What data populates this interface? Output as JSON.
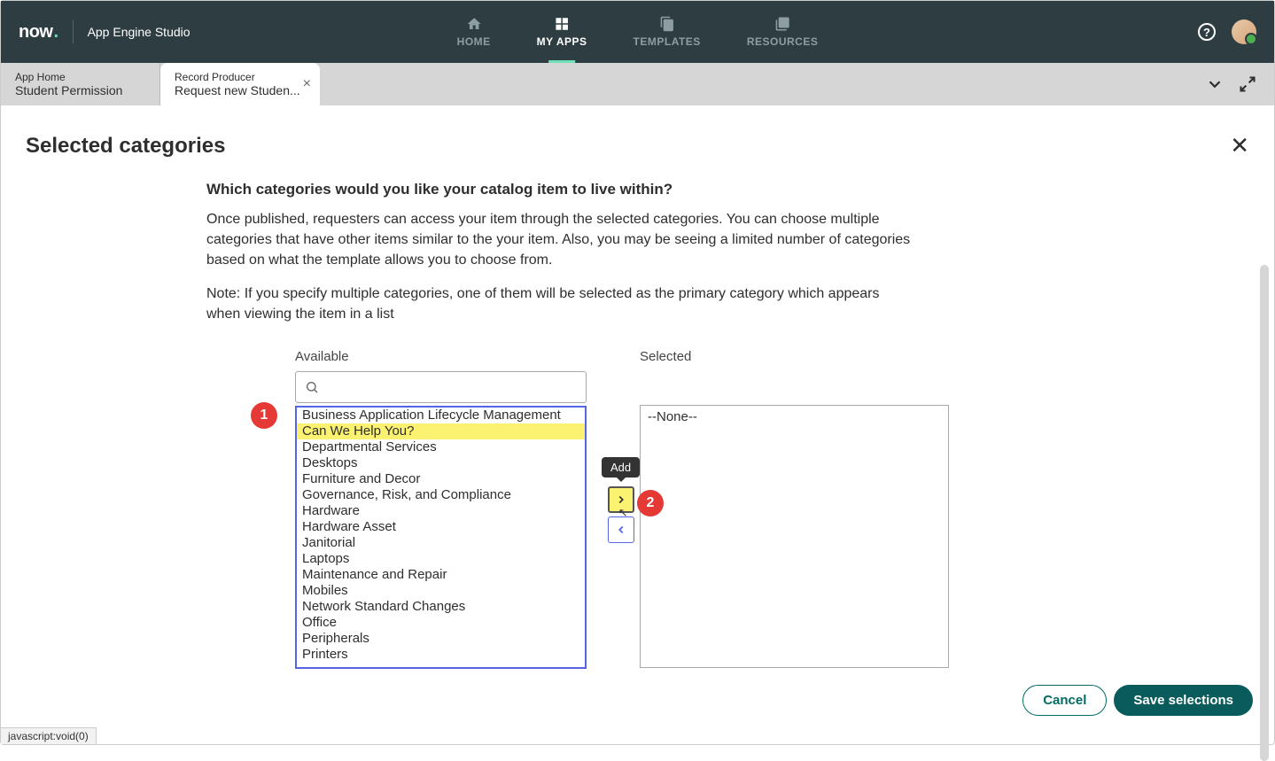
{
  "topbar": {
    "logo": "now",
    "studio": "App Engine Studio",
    "nav": [
      {
        "label": "HOME"
      },
      {
        "label": "MY APPS"
      },
      {
        "label": "TEMPLATES"
      },
      {
        "label": "RESOURCES"
      }
    ],
    "help": "?"
  },
  "tabs": {
    "inactive": {
      "title": "App Home",
      "subtitle": "Student Permission"
    },
    "active": {
      "title": "Record Producer",
      "subtitle": "Request new Studen..."
    }
  },
  "page": {
    "title": "Selected categories",
    "question": "Which categories would you like your catalog item to live within?",
    "para1": "Once published, requesters can access your item through the selected categories. You can choose multiple categories that have other items similar to the your item. Also, you may be seeing a limited number of categories based on what the template allows you to choose from.",
    "para2": "Note: If you specify multiple categories, one of them will be selected as the primary category which appears when viewing the item in a list"
  },
  "slush": {
    "available_label": "Available",
    "selected_label": "Selected",
    "tooltip": "Add",
    "none": "--None--",
    "items": [
      "Business Application Lifecycle Management",
      "Can We Help You?",
      "Departmental Services",
      "Desktops",
      "Furniture and Decor",
      "Governance, Risk, and Compliance",
      "Hardware",
      "Hardware Asset",
      "Janitorial",
      "Laptops",
      "Maintenance and Repair",
      "Mobiles",
      "Network Standard Changes",
      "Office",
      "Peripherals",
      "Printers"
    ]
  },
  "badges": {
    "one": "1",
    "two": "2"
  },
  "footer": {
    "cancel": "Cancel",
    "save": "Save selections"
  },
  "status": "javascript:void(0)"
}
